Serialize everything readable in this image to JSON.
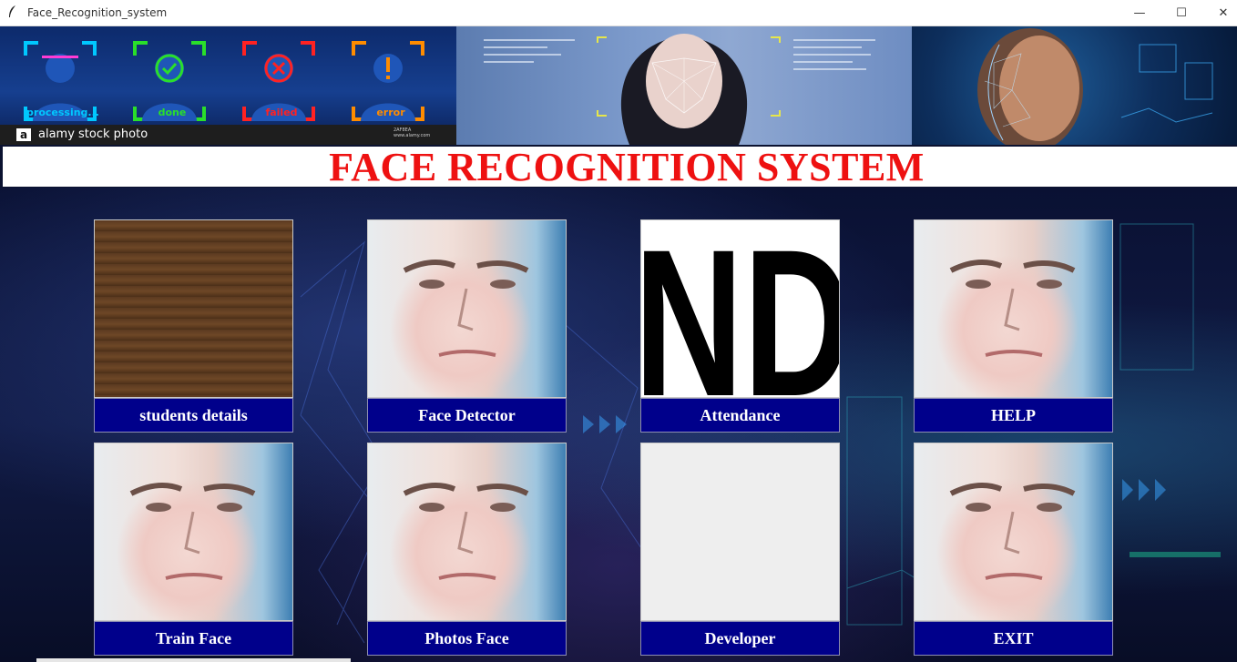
{
  "window": {
    "title": "Face_Recognition_system",
    "controls": {
      "minimize": "—",
      "maximize": "☐",
      "close": "✕"
    }
  },
  "banner": {
    "status_labels": [
      "processing...",
      "done",
      "failed",
      "error"
    ],
    "status_colors": [
      "#00c8ff",
      "#2adf2a",
      "#ff2222",
      "#ff8c00"
    ],
    "watermark": "alamy stock photo",
    "watermark_logo": "a",
    "watermark_meta": [
      "2AF8EA",
      "www.alamy.com"
    ]
  },
  "header": {
    "title": "FACE RECOGNITION SYSTEM",
    "title_color": "#ee1111"
  },
  "tiles": [
    {
      "label": "students details",
      "image": "wood-texture"
    },
    {
      "label": "Face Detector",
      "image": "face-photo"
    },
    {
      "label": "Attendance",
      "image": "letters-ND"
    },
    {
      "label": "HELP",
      "image": "face-photo"
    },
    {
      "label": "Train Face",
      "image": "face-photo"
    },
    {
      "label": "Photos Face",
      "image": "face-photo"
    },
    {
      "label": "Developer",
      "image": "blank"
    },
    {
      "label": "EXIT",
      "image": "face-photo"
    }
  ],
  "attendance_image_text": "ND",
  "colors": {
    "button_bg": "#00008b",
    "button_text": "#ffffff"
  }
}
